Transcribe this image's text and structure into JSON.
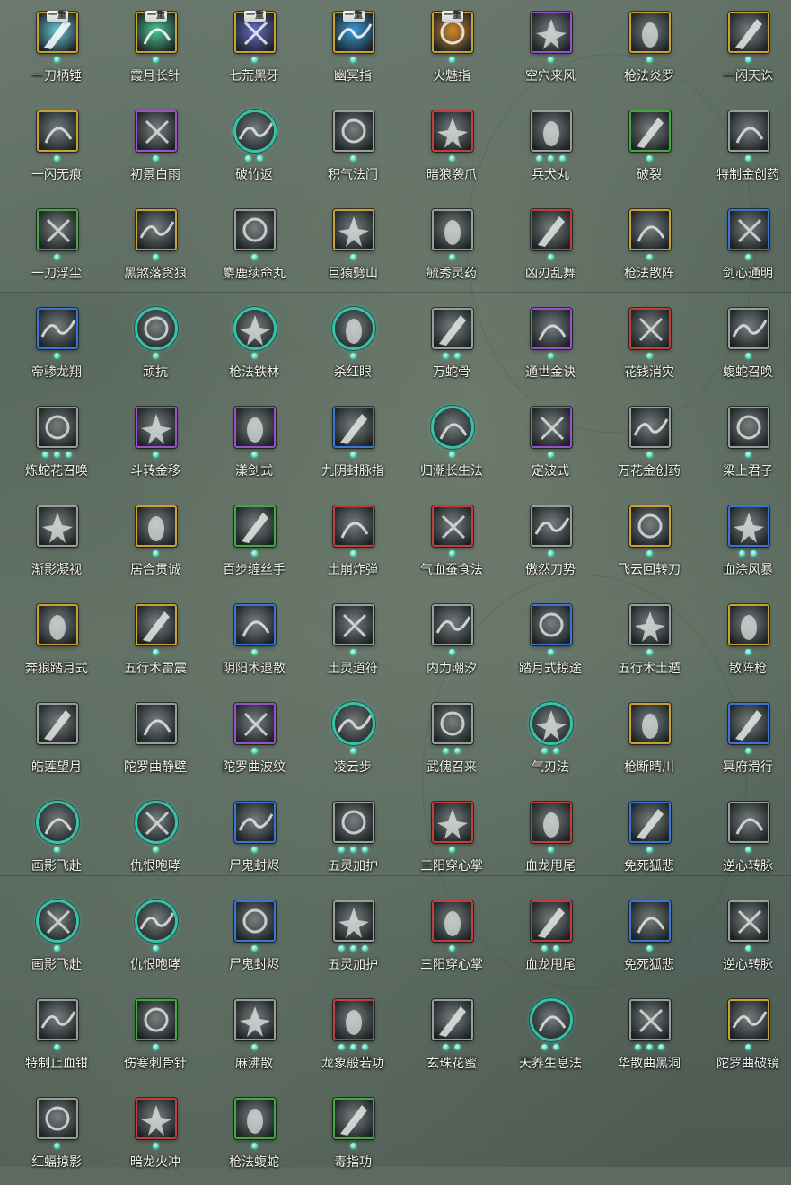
{
  "skills": [
    {
      "name": "一刀柄锤",
      "badge": "一重",
      "frame": "gold",
      "dots": 1,
      "tint": "#6fd6e8"
    },
    {
      "name": "霞月长针",
      "badge": "一重",
      "frame": "gold",
      "dots": 1,
      "tint": "#4fd29a"
    },
    {
      "name": "七荒黑牙",
      "badge": "一重",
      "frame": "gold",
      "dots": 1,
      "tint": "#6a70d6"
    },
    {
      "name": "幽冥指",
      "badge": "一重",
      "frame": "gold",
      "dots": 1,
      "tint": "#3aa6e8"
    },
    {
      "name": "火魅指",
      "badge": "一重",
      "frame": "gold",
      "dots": 1,
      "tint": "#e0902a"
    },
    {
      "name": "空穴来风",
      "badge": "",
      "frame": "purple",
      "dots": 1,
      "tint": ""
    },
    {
      "name": "枪法炎罗",
      "badge": "",
      "frame": "gold",
      "dots": 1,
      "tint": ""
    },
    {
      "name": "一闪天诛",
      "badge": "",
      "frame": "gold",
      "dots": 1,
      "tint": ""
    },
    {
      "name": "一闪无痕",
      "badge": "",
      "frame": "gold",
      "dots": 1,
      "tint": ""
    },
    {
      "name": "初景白雨",
      "badge": "",
      "frame": "purple",
      "dots": 1,
      "tint": ""
    },
    {
      "name": "破竹返",
      "badge": "",
      "frame": "round",
      "dots": 2,
      "tint": ""
    },
    {
      "name": "积气法门",
      "badge": "",
      "frame": "gray",
      "dots": 1,
      "tint": ""
    },
    {
      "name": "暗狼袭爪",
      "badge": "",
      "frame": "red",
      "dots": 1,
      "tint": ""
    },
    {
      "name": "兵犬丸",
      "badge": "",
      "frame": "gray",
      "dots": 3,
      "tint": ""
    },
    {
      "name": "破裂",
      "badge": "",
      "frame": "green",
      "dots": 1,
      "tint": ""
    },
    {
      "name": "特制金创药",
      "badge": "",
      "frame": "gray",
      "dots": 1,
      "tint": ""
    },
    {
      "name": "一刀浮尘",
      "badge": "",
      "frame": "green",
      "dots": 1,
      "tint": ""
    },
    {
      "name": "黑煞落贪狼",
      "badge": "",
      "frame": "gold",
      "dots": 1,
      "tint": ""
    },
    {
      "name": "麝鹿续命丸",
      "badge": "",
      "frame": "gray",
      "dots": 1,
      "tint": ""
    },
    {
      "name": "巨猿劈山",
      "badge": "",
      "frame": "gold",
      "dots": 1,
      "tint": ""
    },
    {
      "name": "毓秀灵药",
      "badge": "",
      "frame": "gray",
      "dots": 1,
      "tint": ""
    },
    {
      "name": "凶刃乱舞",
      "badge": "",
      "frame": "red",
      "dots": 1,
      "tint": ""
    },
    {
      "name": "枪法散阵",
      "badge": "",
      "frame": "gold",
      "dots": 1,
      "tint": ""
    },
    {
      "name": "剑心通明",
      "badge": "",
      "frame": "blue",
      "dots": 1,
      "tint": ""
    },
    {
      "name": "帝骖龙翔",
      "badge": "",
      "frame": "blue",
      "dots": 1,
      "tint": ""
    },
    {
      "name": "顽抗",
      "badge": "",
      "frame": "round",
      "dots": 1,
      "tint": ""
    },
    {
      "name": "枪法铁林",
      "badge": "",
      "frame": "round",
      "dots": 1,
      "tint": ""
    },
    {
      "name": "杀红眼",
      "badge": "",
      "frame": "round",
      "dots": 1,
      "tint": ""
    },
    {
      "name": "万蛇骨",
      "badge": "",
      "frame": "gray",
      "dots": 2,
      "tint": ""
    },
    {
      "name": "通世金诀",
      "badge": "",
      "frame": "purple",
      "dots": 1,
      "tint": ""
    },
    {
      "name": "花钱消灾",
      "badge": "",
      "frame": "red",
      "dots": 1,
      "tint": ""
    },
    {
      "name": "蝮蛇召唤",
      "badge": "",
      "frame": "gray",
      "dots": 1,
      "tint": ""
    },
    {
      "name": "炼蛇花召唤",
      "badge": "",
      "frame": "gray",
      "dots": 3,
      "tint": ""
    },
    {
      "name": "斗转金移",
      "badge": "",
      "frame": "purple",
      "dots": 1,
      "tint": ""
    },
    {
      "name": "漾剑式",
      "badge": "",
      "frame": "purple",
      "dots": 1,
      "tint": ""
    },
    {
      "name": "九阴封脉指",
      "badge": "",
      "frame": "blue",
      "dots": 1,
      "tint": ""
    },
    {
      "name": "归潮长生法",
      "badge": "",
      "frame": "round",
      "dots": 1,
      "tint": ""
    },
    {
      "name": "定波式",
      "badge": "",
      "frame": "purple",
      "dots": 1,
      "tint": ""
    },
    {
      "name": "万花金创药",
      "badge": "",
      "frame": "gray",
      "dots": 1,
      "tint": ""
    },
    {
      "name": "梁上君子",
      "badge": "",
      "frame": "gray",
      "dots": 1,
      "tint": ""
    },
    {
      "name": "渐影凝视",
      "badge": "",
      "frame": "gray",
      "dots": 0,
      "tint": ""
    },
    {
      "name": "居合贯诚",
      "badge": "",
      "frame": "gold",
      "dots": 1,
      "tint": ""
    },
    {
      "name": "百步缠丝手",
      "badge": "",
      "frame": "green",
      "dots": 1,
      "tint": ""
    },
    {
      "name": "土崩炸弹",
      "badge": "",
      "frame": "red",
      "dots": 1,
      "tint": ""
    },
    {
      "name": "气血蚕食法",
      "badge": "",
      "frame": "red",
      "dots": 1,
      "tint": ""
    },
    {
      "name": "傲然刀势",
      "badge": "",
      "frame": "gray",
      "dots": 1,
      "tint": ""
    },
    {
      "name": "飞云回转刀",
      "badge": "",
      "frame": "gold",
      "dots": 1,
      "tint": ""
    },
    {
      "name": "血涂风暴",
      "badge": "",
      "frame": "blue",
      "dots": 2,
      "tint": ""
    },
    {
      "name": "奔狼踏月式",
      "badge": "",
      "frame": "gold",
      "dots": 0,
      "tint": ""
    },
    {
      "name": "五行术雷震",
      "badge": "",
      "frame": "gold",
      "dots": 1,
      "tint": ""
    },
    {
      "name": "阴阳术退散",
      "badge": "",
      "frame": "blue",
      "dots": 1,
      "tint": ""
    },
    {
      "name": "土灵道符",
      "badge": "",
      "frame": "gray",
      "dots": 1,
      "tint": ""
    },
    {
      "name": "内力潮汐",
      "badge": "",
      "frame": "gray",
      "dots": 1,
      "tint": ""
    },
    {
      "name": "踏月式掠途",
      "badge": "",
      "frame": "blue",
      "dots": 1,
      "tint": ""
    },
    {
      "name": "五行术土遁",
      "badge": "",
      "frame": "gray",
      "dots": 1,
      "tint": ""
    },
    {
      "name": "散阵枪",
      "badge": "",
      "frame": "gold",
      "dots": 1,
      "tint": ""
    },
    {
      "name": "皓莲望月",
      "badge": "",
      "frame": "gray",
      "dots": 0,
      "tint": ""
    },
    {
      "name": "陀罗曲静壁",
      "badge": "",
      "frame": "gray",
      "dots": 0,
      "tint": ""
    },
    {
      "name": "陀罗曲波纹",
      "badge": "",
      "frame": "purple",
      "dots": 1,
      "tint": ""
    },
    {
      "name": "凌云步",
      "badge": "",
      "frame": "round",
      "dots": 1,
      "tint": ""
    },
    {
      "name": "武傀召来",
      "badge": "",
      "frame": "gray",
      "dots": 2,
      "tint": ""
    },
    {
      "name": "气刃法",
      "badge": "",
      "frame": "round",
      "dots": 2,
      "tint": ""
    },
    {
      "name": "枪断晴川",
      "badge": "",
      "frame": "gold",
      "dots": 0,
      "tint": ""
    },
    {
      "name": "冥府滑行",
      "badge": "",
      "frame": "blue",
      "dots": 1,
      "tint": ""
    },
    {
      "name": "画影飞赴",
      "badge": "",
      "frame": "round",
      "dots": 1,
      "tint": ""
    },
    {
      "name": "仇恨咆哮",
      "badge": "",
      "frame": "round",
      "dots": 1,
      "tint": ""
    },
    {
      "name": "尸鬼封烬",
      "badge": "",
      "frame": "blue",
      "dots": 1,
      "tint": ""
    },
    {
      "name": "五灵加护",
      "badge": "",
      "frame": "gray",
      "dots": 3,
      "tint": ""
    },
    {
      "name": "三阳穿心掌",
      "badge": "",
      "frame": "red",
      "dots": 1,
      "tint": ""
    },
    {
      "name": "血龙甩尾",
      "badge": "",
      "frame": "red",
      "dots": 1,
      "tint": ""
    },
    {
      "name": "免死狐悲",
      "badge": "",
      "frame": "blue",
      "dots": 1,
      "tint": ""
    },
    {
      "name": "逆心转脉",
      "badge": "",
      "frame": "gray",
      "dots": 1,
      "tint": ""
    },
    {
      "name": "画影飞赴",
      "badge": "",
      "frame": "round",
      "dots": 1,
      "tint": ""
    },
    {
      "name": "仇恨咆哮",
      "badge": "",
      "frame": "round",
      "dots": 1,
      "tint": ""
    },
    {
      "name": "尸鬼封烬",
      "badge": "",
      "frame": "blue",
      "dots": 1,
      "tint": ""
    },
    {
      "name": "五灵加护",
      "badge": "",
      "frame": "gray",
      "dots": 3,
      "tint": ""
    },
    {
      "name": "三阳穿心掌",
      "badge": "",
      "frame": "red",
      "dots": 1,
      "tint": ""
    },
    {
      "name": "血龙甩尾",
      "badge": "",
      "frame": "red",
      "dots": 2,
      "tint": ""
    },
    {
      "name": "免死狐悲",
      "badge": "",
      "frame": "blue",
      "dots": 1,
      "tint": ""
    },
    {
      "name": "逆心转脉",
      "badge": "",
      "frame": "gray",
      "dots": 1,
      "tint": ""
    },
    {
      "name": "特制止血钳",
      "badge": "",
      "frame": "gray",
      "dots": 1,
      "tint": ""
    },
    {
      "name": "伤寒刺骨针",
      "badge": "",
      "frame": "green",
      "dots": 1,
      "tint": ""
    },
    {
      "name": "麻沸散",
      "badge": "",
      "frame": "gray",
      "dots": 1,
      "tint": ""
    },
    {
      "name": "龙象般若功",
      "badge": "",
      "frame": "red",
      "dots": 3,
      "tint": ""
    },
    {
      "name": "玄珠花蜜",
      "badge": "",
      "frame": "gray",
      "dots": 2,
      "tint": ""
    },
    {
      "name": "天养生息法",
      "badge": "",
      "frame": "round",
      "dots": 2,
      "tint": ""
    },
    {
      "name": "华散曲黑洞",
      "badge": "",
      "frame": "gray",
      "dots": 3,
      "tint": ""
    },
    {
      "name": "陀罗曲破镜",
      "badge": "",
      "frame": "gold",
      "dots": 1,
      "tint": ""
    },
    {
      "name": "红蝠掠影",
      "badge": "",
      "frame": "gray",
      "dots": 1,
      "tint": ""
    },
    {
      "name": "暗龙火冲",
      "badge": "",
      "frame": "red",
      "dots": 1,
      "tint": ""
    },
    {
      "name": "枪法蝮蛇",
      "badge": "",
      "frame": "green",
      "dots": 1,
      "tint": ""
    },
    {
      "name": "毒指功",
      "badge": "",
      "frame": "green",
      "dots": 1,
      "tint": ""
    }
  ],
  "colors": {
    "label": "#f2f2ee",
    "dot": "#56dcbf",
    "round_ring": "#35c2a6"
  }
}
